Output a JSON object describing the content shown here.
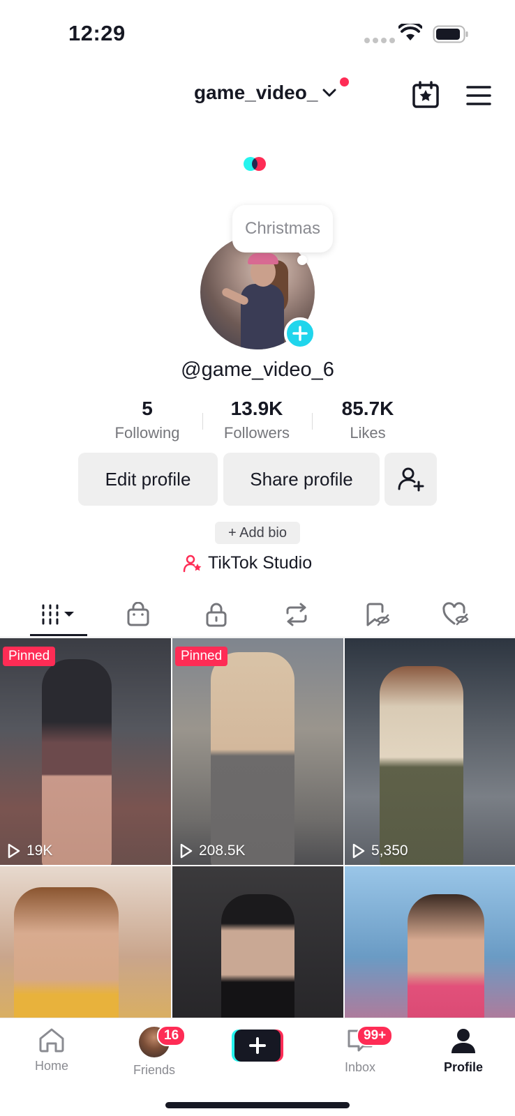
{
  "status_bar": {
    "time": "12:29"
  },
  "header": {
    "username": "game_video_"
  },
  "note": {
    "text": "Christmas"
  },
  "profile": {
    "handle": "@game_video_6"
  },
  "stats": [
    {
      "value": "5",
      "label": "Following"
    },
    {
      "value": "13.9K",
      "label": "Followers"
    },
    {
      "value": "85.7K",
      "label": "Likes"
    }
  ],
  "actions": {
    "edit": "Edit profile",
    "share": "Share profile"
  },
  "bio": {
    "add": "+ Add bio"
  },
  "studio": {
    "label": "TikTok Studio"
  },
  "tabs": [
    {
      "icon": "videos-grid-icon"
    },
    {
      "icon": "shop-bag-icon"
    },
    {
      "icon": "lock-icon"
    },
    {
      "icon": "repost-icon"
    },
    {
      "icon": "favorites-hidden-icon"
    },
    {
      "icon": "liked-hidden-icon"
    }
  ],
  "videos": [
    {
      "pinned": "Pinned",
      "views": "19K"
    },
    {
      "pinned": "Pinned",
      "views": "208.5K"
    },
    {
      "pinned": "",
      "views": "5,350"
    },
    {
      "pinned": "",
      "views": ""
    },
    {
      "pinned": "",
      "views": ""
    },
    {
      "pinned": "",
      "views": ""
    }
  ],
  "nav": {
    "home": "Home",
    "friends": "Friends",
    "friends_badge": "16",
    "inbox": "Inbox",
    "inbox_badge": "99+",
    "profile": "Profile"
  },
  "colors": {
    "accent": "#fe2c55",
    "cyan": "#25f4ee",
    "add_button": "#20d5ec"
  }
}
